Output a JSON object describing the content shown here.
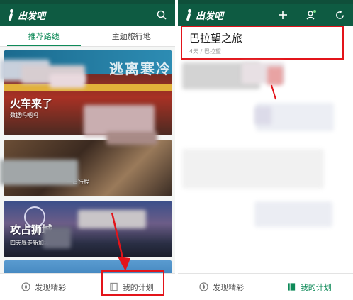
{
  "left": {
    "app_name": "出发吧",
    "tabs": [
      {
        "label": "推荐路线",
        "active": true
      },
      {
        "label": "主题旅行地",
        "active": false
      }
    ],
    "cards": [
      {
        "title": "火车来了",
        "subtitle": "数据吗吧吗",
        "banner": "逃离寒冷"
      },
      {
        "title": "",
        "subtitle": "一日行程"
      },
      {
        "title": "攻占狮城",
        "subtitle": "四天暴走新加坡"
      },
      {
        "title": "",
        "subtitle": ""
      }
    ],
    "bottom_nav": [
      {
        "label": "发现精彩",
        "icon": "compass-icon",
        "active": false
      },
      {
        "label": "我的计划",
        "icon": "notebook-icon",
        "active": false
      }
    ]
  },
  "right": {
    "app_name": "出发吧",
    "plan": {
      "title": "巴拉望之旅",
      "meta": "4天 / 巴拉望"
    },
    "bottom_nav": [
      {
        "label": "发现精彩",
        "icon": "compass-icon",
        "active": false
      },
      {
        "label": "我的计划",
        "icon": "notebook-icon",
        "active": true
      }
    ]
  },
  "colors": {
    "brand_dark": "#0e5b42",
    "accent_green": "#0e8a58",
    "highlight_red": "#e3141a"
  }
}
